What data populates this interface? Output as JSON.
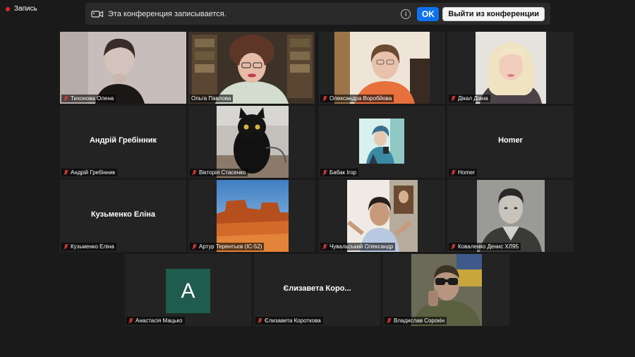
{
  "recording": {
    "label": "Запись"
  },
  "banner": {
    "text": "Эта конференция записывается.",
    "ok_label": "OK",
    "leave_label": "Выйти из конференции"
  },
  "participants": [
    {
      "name": "Тихонова Олена"
    },
    {
      "name": "Ольга Павлова"
    },
    {
      "name": "Олександра Воробйова"
    },
    {
      "name": "Дікал Діана"
    },
    {
      "name": "Андрій Гребінник",
      "display": "Андрій Гребінник"
    },
    {
      "name": "Вікторія Стасенко"
    },
    {
      "name": "Бабак Ігор"
    },
    {
      "name": "Homer",
      "display": "Homer"
    },
    {
      "name": "Кузьменко Еліна",
      "display": "Кузьменко Еліна"
    },
    {
      "name": "Артур Терентьєв (IC-52)"
    },
    {
      "name": "Чувальський Олександр"
    },
    {
      "name": "Коваленко Денис ХЛ95"
    },
    {
      "name": "Анастасія Мацько",
      "avatar_letter": "A"
    },
    {
      "name": "Єлизавета Короткова",
      "display": "Єлизавета Коро..."
    },
    {
      "name": "Владислав Сорокін"
    }
  ]
}
